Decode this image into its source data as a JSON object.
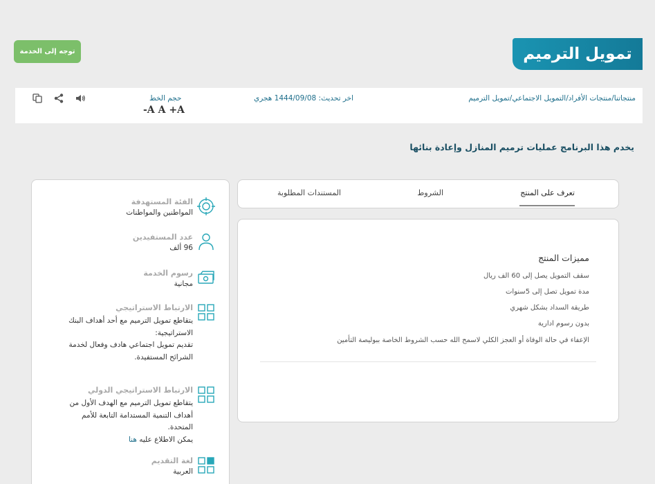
{
  "header": {
    "title": "تمويل الترميم",
    "go_button": "توجه إلى الخدمة"
  },
  "infobar": {
    "breadcrumb": [
      "منتجاتنا",
      "منتجات الأفراد",
      "التمويل الاجتماعي",
      "تمويل الترميم"
    ],
    "separator": "/",
    "last_updated": "اخر تحديث: 1444/09/08 هجري",
    "font_size_label": "حجم الخط",
    "font_controls": [
      "-A",
      "A",
      "+A"
    ],
    "icons": [
      "copy-icon",
      "share-icon",
      "speaker-icon"
    ]
  },
  "tagline": "يخدم هذا البرنامج عمليات ترميم المنازل وإعادة بنائها",
  "tabs": [
    {
      "label": "تعرف على المنتج",
      "active": true
    },
    {
      "label": "الشروط",
      "active": false
    },
    {
      "label": "المستندات المطلوبة",
      "active": false
    }
  ],
  "content": {
    "features_title": "مميزات المنتج",
    "features": [
      "سقف التمويل يصل إلى 60 الف ريال",
      "مدة تمويل تصل إلى 5سنوات",
      "طريقة السداد بشكل شهري",
      "بدون رسوم ادارية",
      "الإعفاء في حالة الوفاة أو العجز الكلي لاسمح الله حسب الشروط الخاصة ببوليصة التأمين"
    ]
  },
  "sidebar": {
    "target_group": {
      "label": "الفئة المستهدفة",
      "value": "المواطنين والمواطنات",
      "icon": "target-icon"
    },
    "beneficiaries": {
      "label": "عدد المستفيدين",
      "value": "96 ألف",
      "icon": "person-icon"
    },
    "service_fees": {
      "label": "رسوم الخدمة",
      "value": "مجانية",
      "icon": "money-icon"
    },
    "strategic": {
      "label": "الارتباط الاستراتيجي",
      "lines": [
        "يتقاطع تمويل الترميم مع أحد أهداف البنك",
        "الاستراتيجية:",
        "تقديم تمويل اجتماعي هادف وفعال لخدمة",
        "الشرائح المستفيدة."
      ],
      "icon": "grid-icon"
    },
    "international": {
      "label": "الارتباط الاستراتيجي الدولي",
      "lines": [
        "يتقاطع تمويل الترميم مع الهدف الأول من",
        "أهداف التنمية المستدامة التابعة للأمم",
        "المتحدة."
      ],
      "more_prefix": "يمكن الاطلاع عليه",
      "more_link": "هنا",
      "icon": "grid-icon"
    },
    "language": {
      "label": "لغة التقديم",
      "value": "العربية",
      "icon": "grid-filled-icon"
    }
  },
  "colors": {
    "brand": "#1a94b2",
    "accent": "#7cbf6a",
    "link": "#1c6d8a"
  }
}
